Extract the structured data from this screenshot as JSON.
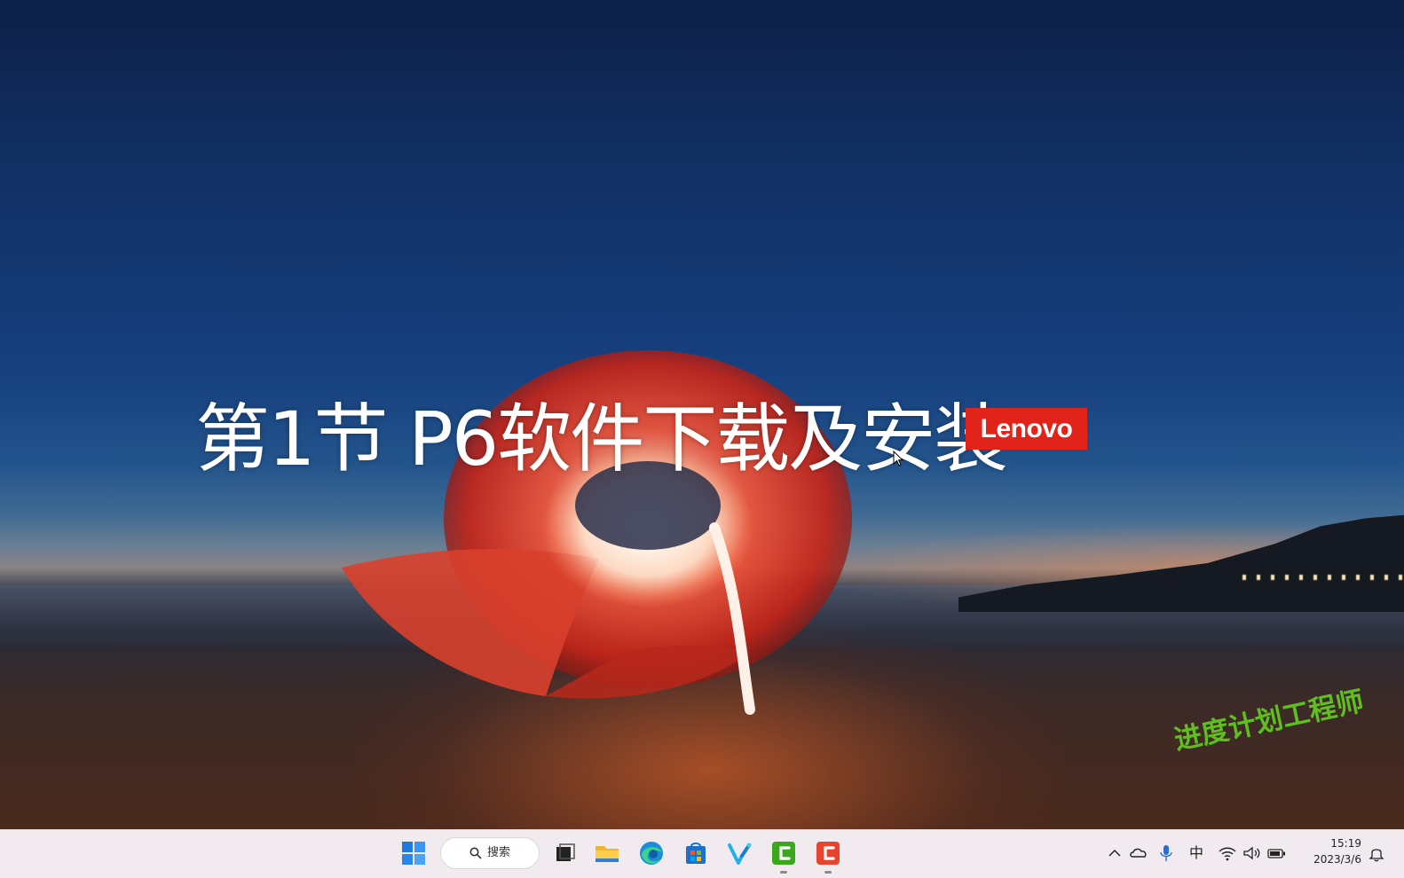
{
  "slide": {
    "title": "第1节 P6软件下载及安装",
    "logo_text": "Lenovo",
    "watermark": "进度计划工程师"
  },
  "taskbar": {
    "search_label": "搜索",
    "pinned": [
      "start-icon",
      "task-view-icon",
      "file-explorer-icon",
      "edge-icon",
      "microsoft-store-icon",
      "app-v-icon",
      "app-green-c-icon",
      "app-red-c-icon"
    ],
    "tray": {
      "ime": "中",
      "time": "15:19",
      "date": "2023/3/6"
    }
  },
  "colors": {
    "logo_red": "#e2231a",
    "watermark_green": "#5fbf1f",
    "taskbar_bg": "#f1ebef"
  }
}
